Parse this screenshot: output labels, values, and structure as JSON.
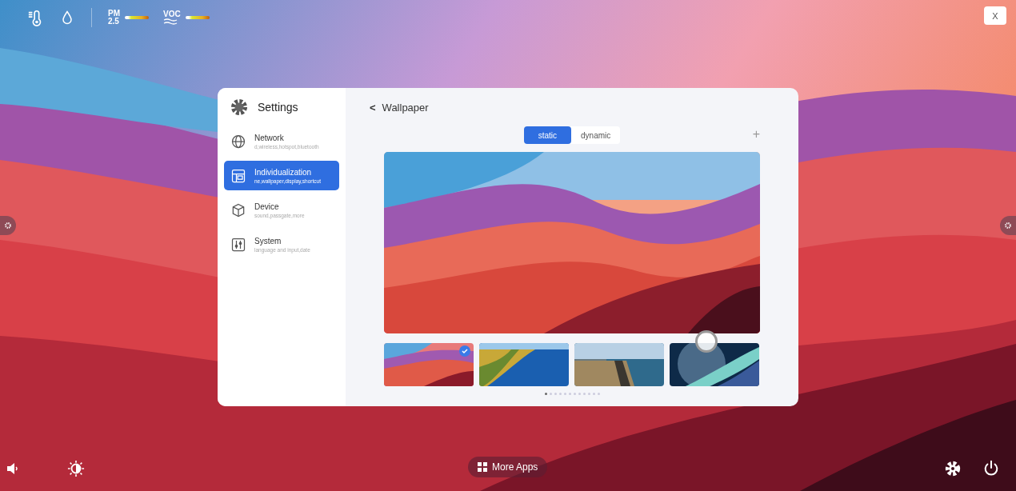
{
  "top_bar": {
    "sensors": [
      {
        "label_lines": [
          "PM",
          "2.5"
        ]
      },
      {
        "label_lines": [
          "VOC"
        ]
      }
    ]
  },
  "close_button": {
    "label": "X"
  },
  "settings": {
    "title": "Settings",
    "items": [
      {
        "name": "Network",
        "description": "d,wireless,hotspot,bluetooth",
        "selected": false
      },
      {
        "name": "Individualization",
        "description": "ne,wallpaper,display,shortcut",
        "selected": true
      },
      {
        "name": "Device",
        "description": "sound,passgate,more",
        "selected": false
      },
      {
        "name": "System",
        "description": "language and input,date",
        "selected": false
      }
    ]
  },
  "wallpaper": {
    "title": "Wallpaper",
    "back": "<",
    "add": "+",
    "tabs": [
      {
        "label": "static",
        "selected": true
      },
      {
        "label": "dynamic",
        "selected": false
      }
    ],
    "thumbnails": [
      {
        "selected": true
      },
      {
        "selected": false
      },
      {
        "selected": false
      },
      {
        "selected": false
      }
    ],
    "page_dots": [
      {
        "selected": true
      },
      {
        "selected": false
      },
      {
        "selected": false
      },
      {
        "selected": false
      },
      {
        "selected": false
      },
      {
        "selected": false
      },
      {
        "selected": false
      },
      {
        "selected": false
      },
      {
        "selected": false
      },
      {
        "selected": false
      },
      {
        "selected": false
      },
      {
        "selected": false
      }
    ]
  },
  "bottom_bar": {
    "more_apps": "More Apps"
  }
}
